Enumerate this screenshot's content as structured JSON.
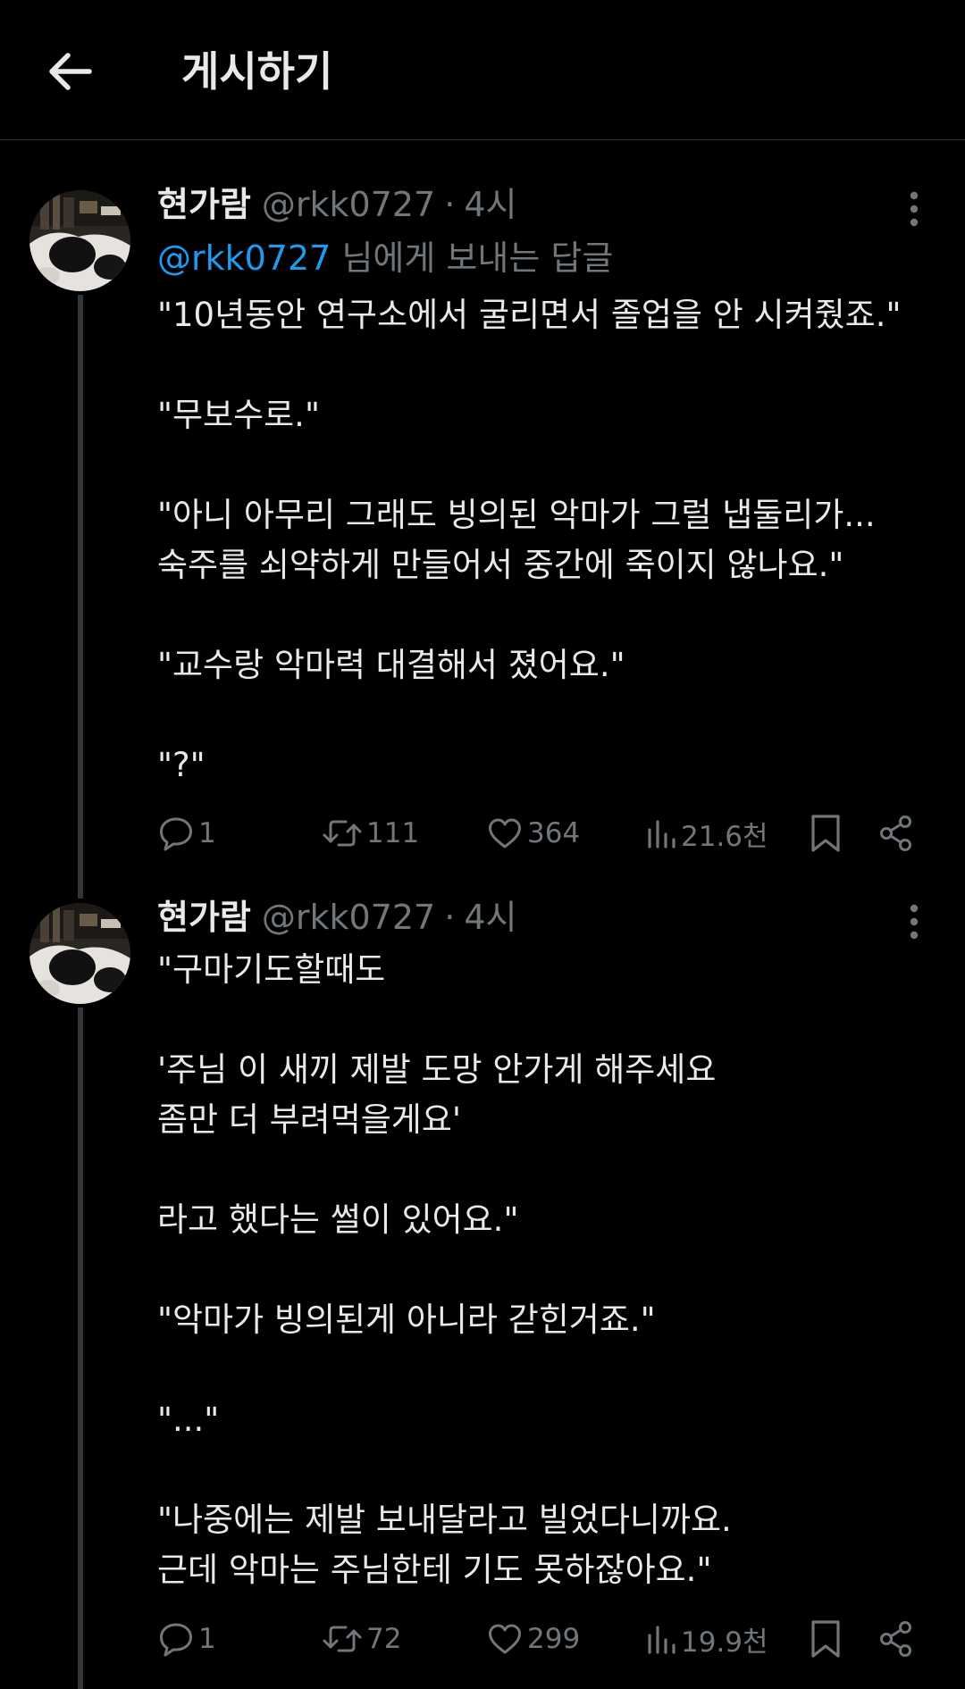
{
  "header": {
    "title": "게시하기",
    "back_icon": "arrow-left-icon"
  },
  "colors": {
    "background": "#000000",
    "text": "#e7e9ea",
    "muted": "#71767b",
    "link": "#1d9bf0",
    "divider": "#2f3336"
  },
  "posts": [
    {
      "author": {
        "name": "현가람",
        "handle": "@rkk0727"
      },
      "time": "4시",
      "separator": "·",
      "reply_to": {
        "handle": "@rkk0727",
        "suffix": "님에게 보내는 답글"
      },
      "body": "\"10년동안 연구소에서 굴리면서 졸업을 안 시켜줬죠.\"\n\n\"무보수로.\"\n\n\"아니 아무리 그래도 빙의된 악마가 그럴 냅둘리가...\n숙주를 쇠약하게 만들어서 중간에 죽이지 않나요.\"\n\n\"교수랑 악마력 대결해서 졌어요.\"\n\n\"?\"",
      "stats": {
        "replies": "1",
        "reposts": "111",
        "likes": "364",
        "views": "21.6천"
      }
    },
    {
      "author": {
        "name": "현가람",
        "handle": "@rkk0727"
      },
      "time": "4시",
      "separator": "·",
      "body": "\"구마기도할때도\n\n'주님 이 새끼 제발 도망 안가게 해주세요\n좀만 더 부려먹을게요'\n\n라고 했다는 썰이 있어요.\"\n\n\"악마가 빙의된게 아니라 갇힌거죠.\"\n\n\"...\"\n\n\"나중에는 제발 보내달라고 빌었다니까요.\n근데 악마는 주님한테 기도 못하잖아요.\"",
      "stats": {
        "replies": "1",
        "reposts": "72",
        "likes": "299",
        "views": "19.9천"
      }
    }
  ]
}
